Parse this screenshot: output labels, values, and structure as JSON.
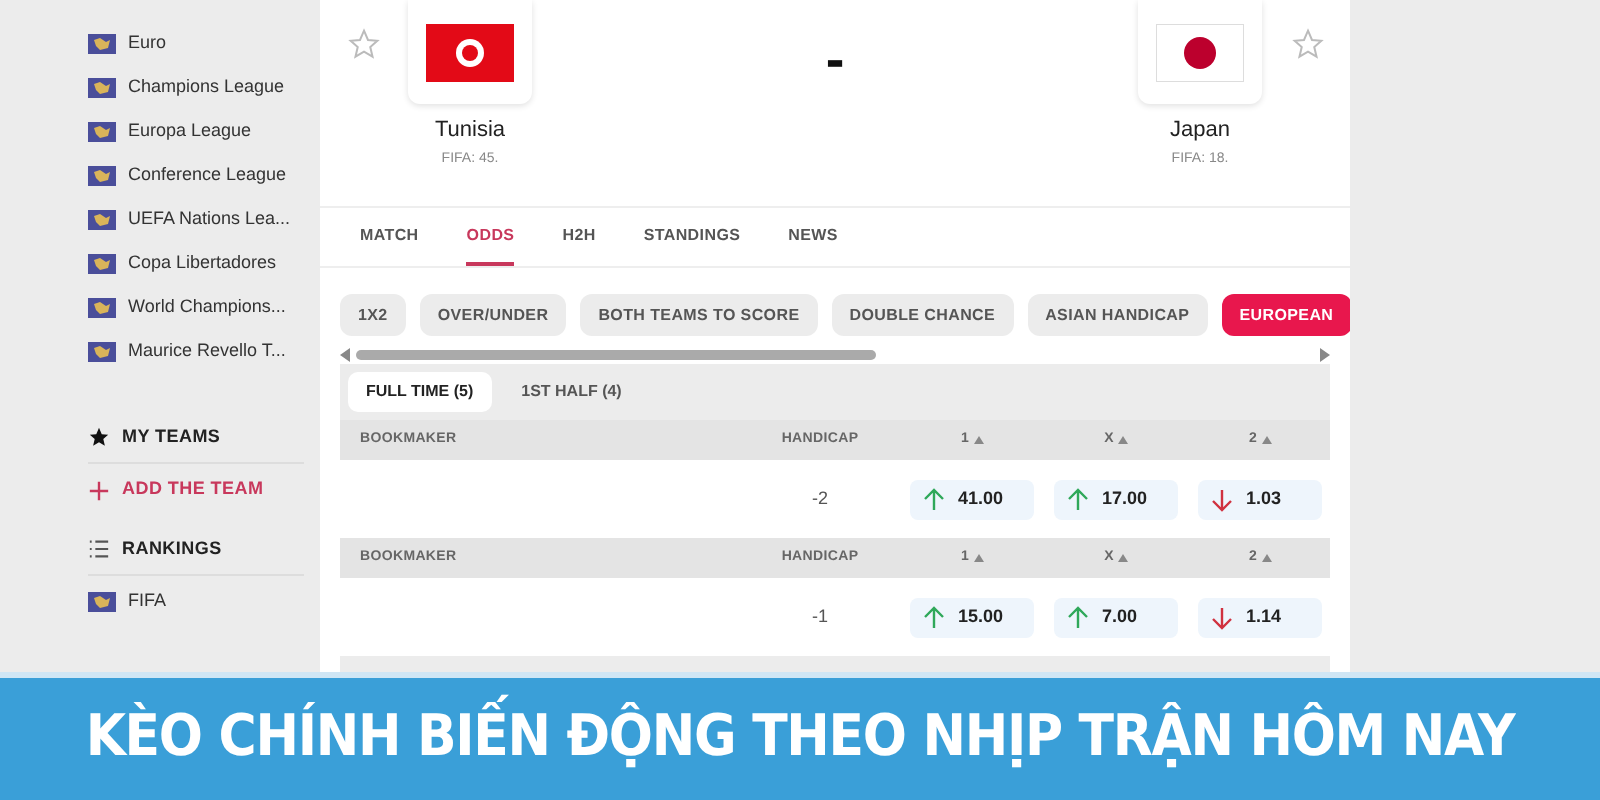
{
  "sidebar": {
    "competitions": [
      {
        "label": "Euro"
      },
      {
        "label": "Champions League"
      },
      {
        "label": "Europa League"
      },
      {
        "label": "Conference League"
      },
      {
        "label": "UEFA Nations Lea..."
      },
      {
        "label": "Copa Libertadores"
      },
      {
        "label": "World Champions..."
      },
      {
        "label": "Maurice Revello T..."
      }
    ],
    "my_teams": {
      "title": "MY TEAMS",
      "add": "ADD THE TEAM"
    },
    "rankings": {
      "title": "RANKINGS",
      "items": [
        {
          "label": "FIFA"
        }
      ]
    }
  },
  "match": {
    "home": {
      "name": "Tunisia",
      "rank": "FIFA: 45.",
      "favorite": false
    },
    "score": "-",
    "away": {
      "name": "Japan",
      "rank": "FIFA: 18.",
      "favorite": false
    }
  },
  "tabs": [
    {
      "label": "MATCH",
      "selected": false
    },
    {
      "label": "ODDS",
      "selected": true
    },
    {
      "label": "H2H",
      "selected": false
    },
    {
      "label": "STANDINGS",
      "selected": false
    },
    {
      "label": "NEWS",
      "selected": false
    }
  ],
  "markets": [
    {
      "label": "1X2",
      "selected": false
    },
    {
      "label": "OVER/UNDER",
      "selected": false
    },
    {
      "label": "BOTH TEAMS TO SCORE",
      "selected": false
    },
    {
      "label": "DOUBLE CHANCE",
      "selected": false
    },
    {
      "label": "ASIAN HANDICAP",
      "selected": false
    },
    {
      "label": "EUROPEAN",
      "selected": true
    }
  ],
  "periods": [
    {
      "label": "FULL TIME (5)",
      "selected": true
    },
    {
      "label": "1ST HALF (4)",
      "selected": false
    }
  ],
  "odds_groups": [
    {
      "columns": [
        "BOOKMAKER",
        "HANDICAP",
        "1",
        "X",
        "2"
      ],
      "handicap": "-2",
      "odds": [
        {
          "value": "41.00",
          "kind": "up"
        },
        {
          "value": "17.00",
          "kind": "up"
        },
        {
          "value": "1.03",
          "kind": "down"
        }
      ]
    },
    {
      "columns": [
        "BOOKMAKER",
        "HANDICAP",
        "1",
        "X",
        "2"
      ],
      "handicap": "-1",
      "odds": [
        {
          "value": "15.00",
          "kind": "up"
        },
        {
          "value": "7.00",
          "kind": "up"
        },
        {
          "value": "1.14",
          "kind": "down"
        }
      ]
    }
  ],
  "banner": {
    "title": "KÈO CHÍNH BIẾN ĐỘNG THEO NHỊP TRẬN HÔM NAY"
  }
}
